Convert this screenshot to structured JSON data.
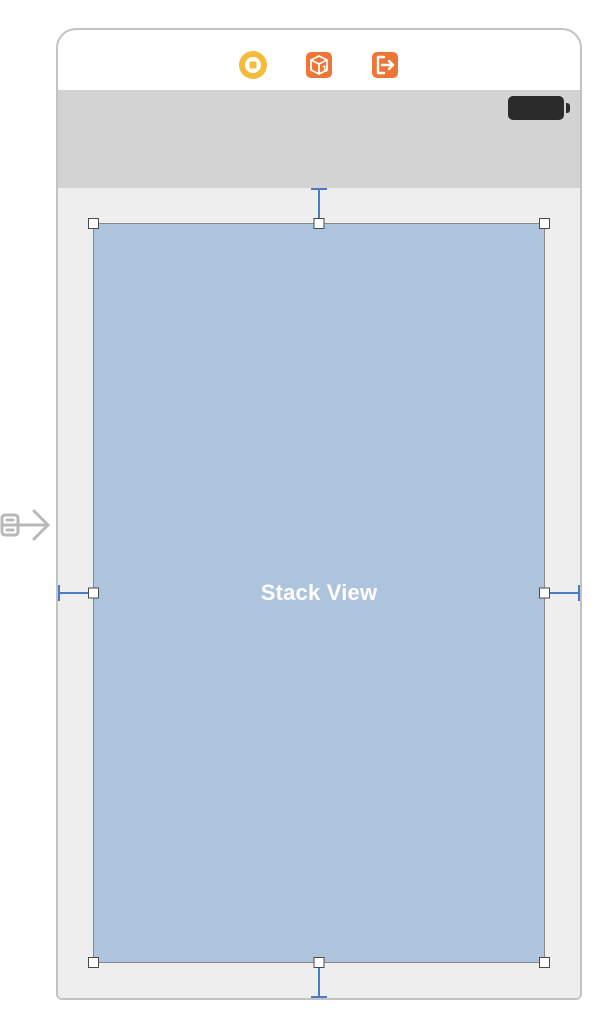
{
  "scene": {
    "dock": {
      "icons": [
        "view-controller-icon",
        "first-responder-icon",
        "exit-icon"
      ]
    },
    "status": {
      "battery_level": "full"
    },
    "selected_view": {
      "label": "Stack View"
    },
    "constraints": [
      "top",
      "bottom",
      "leading",
      "trailing"
    ]
  }
}
